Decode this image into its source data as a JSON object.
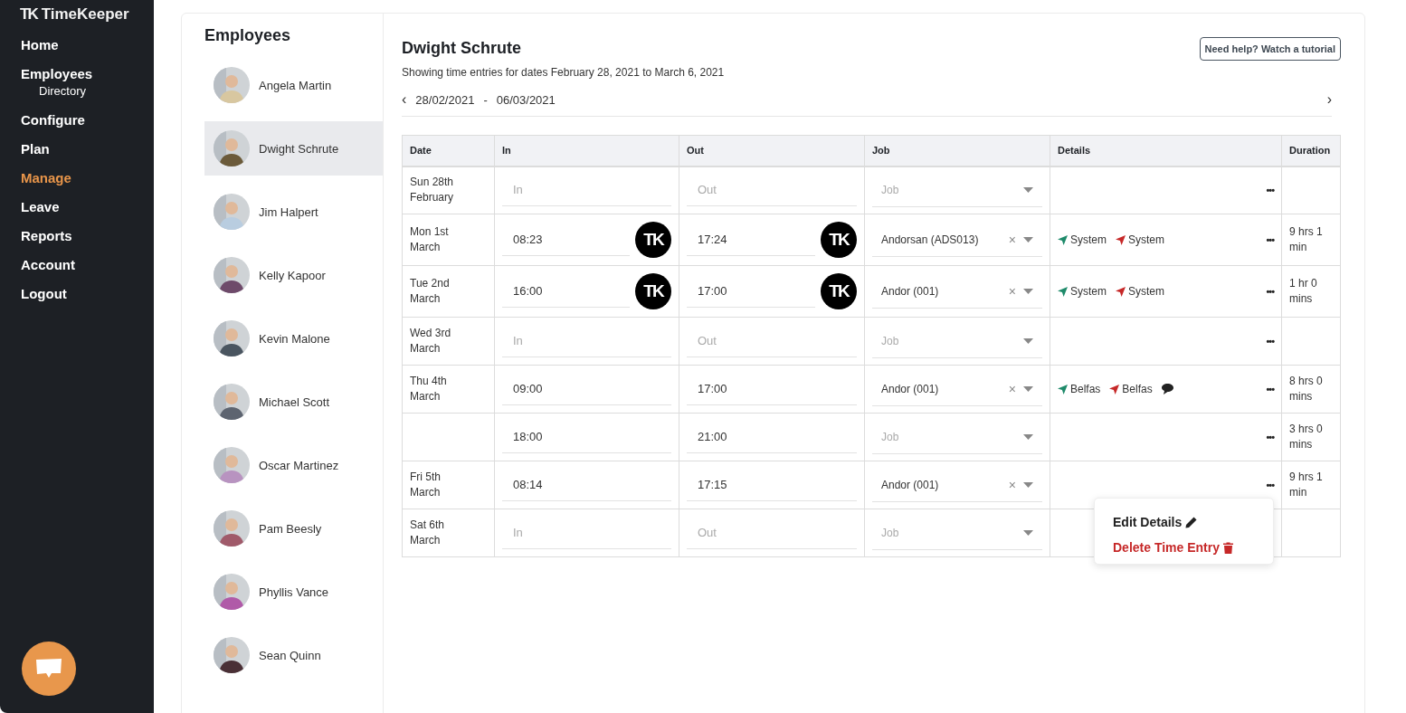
{
  "brand": {
    "mark": "TK",
    "name": "TimeKeeper"
  },
  "nav": [
    {
      "label": "Home",
      "selected": false
    },
    {
      "label": "Employees",
      "selected": false,
      "children": [
        {
          "label": "Directory",
          "selected": false
        }
      ]
    },
    {
      "label": "Configure",
      "selected": false
    },
    {
      "label": "Plan",
      "selected": false
    },
    {
      "label": "Manage",
      "selected": true
    },
    {
      "label": "Leave",
      "selected": false
    },
    {
      "label": "Reports",
      "selected": false
    },
    {
      "label": "Account",
      "selected": false
    },
    {
      "label": "Logout",
      "selected": false
    }
  ],
  "employees": {
    "title": "Employees",
    "items": [
      {
        "name": "Angela Martin",
        "selected": false,
        "color": "#d8c7a0"
      },
      {
        "name": "Dwight Schrute",
        "selected": true,
        "color": "#6b5a3a"
      },
      {
        "name": "Jim Halpert",
        "selected": false,
        "color": "#b9cde0"
      },
      {
        "name": "Kelly Kapoor",
        "selected": false,
        "color": "#6e4a6a"
      },
      {
        "name": "Kevin Malone",
        "selected": false,
        "color": "#4a5560"
      },
      {
        "name": "Michael Scott",
        "selected": false,
        "color": "#5d6470"
      },
      {
        "name": "Oscar Martinez",
        "selected": false,
        "color": "#b893c0"
      },
      {
        "name": "Pam Beesly",
        "selected": false,
        "color": "#a05a6a"
      },
      {
        "name": "Phyllis Vance",
        "selected": false,
        "color": "#b05aa8"
      },
      {
        "name": "Sean Quinn",
        "selected": false,
        "color": "#4a3036"
      }
    ]
  },
  "detail": {
    "title": "Dwight Schrute",
    "help_button": "Need help? Watch a tutorial",
    "subtitle": "Showing time entries for dates February 28, 2021 to March 6, 2021",
    "range": {
      "prev": "‹",
      "start": "28/02/2021",
      "separator": "-",
      "end": "06/03/2021",
      "next": "›"
    },
    "columns": [
      "Date",
      "In",
      "Out",
      "Job",
      "Details",
      "Duration"
    ],
    "rows": [
      {
        "date": "Sun 28th February",
        "in": {
          "placeholder": "In"
        },
        "out": {
          "placeholder": "Out"
        },
        "job": {
          "placeholder": "Job"
        },
        "details": [],
        "more": "•••"
      },
      {
        "date": "Mon 1st March",
        "in": {
          "value": "08:23",
          "badge": "TK"
        },
        "out": {
          "value": "17:24",
          "badge": "TK"
        },
        "job": {
          "value": "Andorsan (ADS013)",
          "clear": "×"
        },
        "details": [
          {
            "kind": "clock_in",
            "label": "System"
          },
          {
            "kind": "clock_out",
            "label": "System"
          }
        ],
        "more": "•••",
        "duration": "9 hrs 1 min"
      },
      {
        "date": "Tue 2nd March",
        "in": {
          "value": "16:00",
          "badge": "TK"
        },
        "out": {
          "value": "17:00",
          "badge": "TK"
        },
        "job": {
          "value": "Andor (001)",
          "clear": "×"
        },
        "details": [
          {
            "kind": "clock_in",
            "label": "System"
          },
          {
            "kind": "clock_out",
            "label": "System"
          }
        ],
        "more": "•••",
        "duration": "1 hr 0 mins"
      },
      {
        "date": "Wed 3rd March",
        "in": {
          "placeholder": "In"
        },
        "out": {
          "placeholder": "Out"
        },
        "job": {
          "placeholder": "Job"
        },
        "details": [],
        "more": "•••"
      },
      {
        "date": "Thu 4th March",
        "in": {
          "value": "09:00"
        },
        "out": {
          "value": "17:00"
        },
        "job": {
          "value": "Andor (001)",
          "clear": "×"
        },
        "details": [
          {
            "kind": "clock_in",
            "label": "Belfas"
          },
          {
            "kind": "clock_out",
            "label": "Belfas"
          },
          {
            "kind": "comment"
          }
        ],
        "more": "•••",
        "duration": "8 hrs 0 mins"
      },
      {
        "in": {
          "value": "18:00"
        },
        "out": {
          "value": "21:00"
        },
        "job": {
          "placeholder": "Job"
        },
        "details": [],
        "more": "•••",
        "duration": "3 hrs 0 mins"
      },
      {
        "date": "Fri 5th March",
        "in": {
          "value": "08:14"
        },
        "out": {
          "value": "17:15"
        },
        "job": {
          "value": "Andor (001)",
          "clear": "×"
        },
        "details": [],
        "more": "•••",
        "duration": "9 hrs 1 min",
        "menu": [
          {
            "kind": "edit",
            "label": "Edit Details"
          },
          {
            "kind": "delete",
            "label": "Delete Time Entry"
          }
        ]
      },
      {
        "date": "Sat 6th March",
        "in": {
          "placeholder": "In"
        },
        "out": {
          "placeholder": "Out"
        },
        "job": {
          "placeholder": "Job"
        },
        "details": []
      }
    ]
  }
}
